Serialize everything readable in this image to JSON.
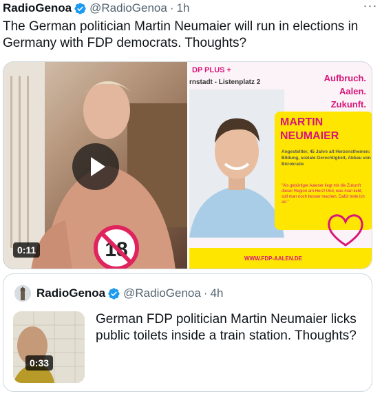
{
  "tweet": {
    "author_name": "RadioGenoa",
    "handle": "@RadioGenoa",
    "separator": "·",
    "time": "1h",
    "more_label": "···",
    "text": "The German politician Martin Neumaier will run in elections in Germany with FDP democrats. Thoughts?",
    "verified_color": "#1d9bf0"
  },
  "media": {
    "video_duration": "0:11",
    "age_badge": "18",
    "poster": {
      "title": "DP PLUS +",
      "subtitle": "rnstadt - Listenplatz 2",
      "slogan_1": "Aufbruch.",
      "slogan_2": "Aalen.",
      "slogan_3": "Zukunft.",
      "name_1": "MARTIN",
      "name_2": "NEUMAIER",
      "info": "Angestellter, 45 Jahre alt Herzensthemen: Bildung, soziale Gerechtigkeit, Abbau von Bürokratie",
      "quote": "\"Als gebürtiger Aalener liegt mir die Zukunft dieser Region am Herz! Und, was man liebt, soll man noch besser machen. Dafür trete ich an.\"",
      "url": "WWW.FDP-AALEN.DE",
      "accent_color": "#d8157b",
      "card_color": "#ffe600"
    }
  },
  "quoted": {
    "author_name": "RadioGenoa",
    "handle": "@RadioGenoa",
    "separator": "·",
    "time": "4h",
    "video_duration": "0:33",
    "text": "German FDP politician Martin Neumaier licks public toilets inside a train station. Thoughts?"
  }
}
